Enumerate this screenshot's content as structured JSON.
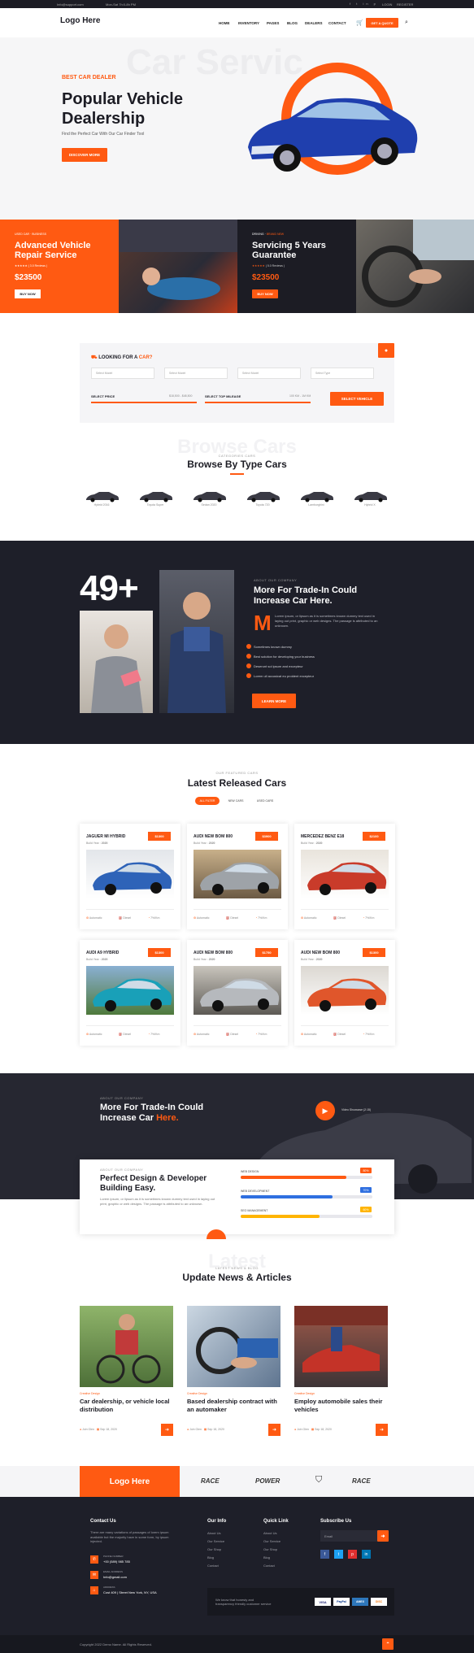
{
  "topbar": {
    "email": "Info@support.com",
    "hours": "Mon-Sat 7h:0-8h PM",
    "login": "LOGIN",
    "register": "REGISTER"
  },
  "nav": {
    "logo": "Logo Here",
    "items": [
      "HOME",
      "INVENTORY",
      "PAGES",
      "BLOG",
      "DEALERS",
      "CONTACT"
    ],
    "cta": "GET A QUOTE"
  },
  "hero": {
    "eyebrow": "BEST CAR DEALER",
    "title_line1": "Popular Vehicle",
    "title_line2": "Dealership",
    "subtitle": "Find the Perfect Car With Our Car Finder Tool",
    "button": "DISCOVER MORE",
    "bg_text": "Car Servic"
  },
  "promo": [
    {
      "tag1": "USED CAR",
      "tag2": "BUSINESS",
      "title1": "Advanced Vehicle",
      "title2": "Repair Service",
      "reviews": "( 3.0 Reviews )",
      "price": "$23500",
      "button": "BUY NOW"
    },
    {
      "tag1": "DRIVING",
      "tag2": "BRAND NEW",
      "title1": "Servicing 5 Years",
      "title2": "Guarantee",
      "reviews": "( 5.0 Reviews )",
      "price": "$23500",
      "button": "BUY NOW"
    }
  ],
  "search": {
    "heading_pre": "LOOKING FOR A ",
    "heading_accent": "CAR?",
    "selects": [
      "Select Model",
      "Select Model",
      "Select Model",
      "Select Type"
    ],
    "price_label": "SELECT PRICE",
    "price_range": "$18,500 - $48,500",
    "mileage_label": "SELECT TOP MILEAGE",
    "mileage_range": "100 KM - 1M KM",
    "button": "SELECT VEHICLE"
  },
  "types": {
    "bg": "Browse Cars",
    "pre": "CATEGORIES CARS",
    "title": "Browse By Type Cars",
    "items": [
      "Hybrid 2016",
      "Toyota Super",
      "Sedan 2020",
      "Toyota 720",
      "Lamborghini",
      "Hybrid X"
    ]
  },
  "about": {
    "counter": "49+",
    "pre": "ABOUT OUR COMPANY",
    "title_line1": "More For Trade-In Could",
    "title_line2": "Increase Car Here.",
    "dropcap": "M",
    "body": "Lorem ipsum, or lipsum as it is sometimes known dummy text used in laying out print, graphic or web designs. The passage is attributed to an unknown.",
    "list": [
      "Sometimes known dummy",
      "Best solution for developing your business",
      "Deserunt sol ipsum and excepteur",
      "Lorem ull accusicat eu proident excepteur"
    ],
    "button": "LEARN MORE"
  },
  "latest": {
    "pre": "OUR FEATURED CARS",
    "title": "Latest Released Cars",
    "tabs": [
      "ALL FILTER",
      "NEW CARS",
      "USED CARS"
    ],
    "year_prefix": "Build Year : ",
    "cars": [
      {
        "name": "JAGUER MI HYBRID",
        "price": "$1300",
        "year": "2020",
        "specs": [
          "Automatic",
          "Diesel",
          "7%/Km"
        ]
      },
      {
        "name": "AUDI NEW BOM 800",
        "price": "$3900",
        "year": "2020",
        "specs": [
          "Automatic",
          "Diesel",
          "7%/Km"
        ]
      },
      {
        "name": "MERCEDEZ BENZ E18",
        "price": "$2100",
        "year": "2020",
        "specs": [
          "Automatic",
          "Diesel",
          "7%/Km"
        ]
      },
      {
        "name": "AUDI A9 HYBRID",
        "price": "$1300",
        "year": "2020",
        "specs": [
          "Automatic",
          "Diesel",
          "7%/Km"
        ]
      },
      {
        "name": "AUDI NEW BOM 800",
        "price": "$1750",
        "year": "2020",
        "specs": [
          "Automatic",
          "Diesel",
          "7%/Km"
        ]
      },
      {
        "name": "AUDI NEW BOM 800",
        "price": "$1300",
        "year": "2020",
        "specs": [
          "Automatic",
          "Diesel",
          "7%/Km"
        ]
      }
    ]
  },
  "video": {
    "pre": "ABOUT OUR COMPANY",
    "title_line1": "More For Trade-In Could",
    "title_line2_plain": "Increase Car ",
    "title_line2_accent": "Here.",
    "label": "Video Showcase (2:15)"
  },
  "skills": {
    "pre": "ABOUT OUR COMPANY",
    "title_line1": "Perfect Design & Developer",
    "title_line2": "Building Easy.",
    "body": "Lorem ipsum, or lipsum as it is sometimes known dummy text used in laying out print, graphic or web designs. The passage is attributed to an unknown.",
    "bars": [
      {
        "label": "WEB DESIGN",
        "value": "80%",
        "pct": 80,
        "color": "#ff5a12"
      },
      {
        "label": "WEB DEVELOPMENT",
        "value": "70%",
        "pct": 70,
        "color": "#2f6fe0"
      },
      {
        "label": "SEO MANAGEMENT",
        "value": "60%",
        "pct": 60,
        "color": "#ffb400"
      }
    ]
  },
  "news": {
    "bg": "Latest",
    "pre": "LATEST NEWS & BLOG",
    "title": "Update News & Articles",
    "items": [
      {
        "cat": "Creative Design",
        "title": "Car dealership, or vehicle local distribution",
        "author": "Join Glen",
        "date": "Sep 18, 2020"
      },
      {
        "cat": "Creative Design",
        "title": "Based dealership contract with an automaker",
        "author": "Join Glen",
        "date": "Sep 18, 2020"
      },
      {
        "cat": "Creative Design",
        "title": "Employ automobile sales their vehicles",
        "author": "Join Glen",
        "date": "Sep 18, 2020"
      }
    ]
  },
  "brands": {
    "logo": "Logo Here",
    "names": [
      "RACE",
      "POWER",
      "RACE"
    ]
  },
  "footer": {
    "contact": {
      "title": "Contact Us",
      "body": "There are many variations of passages of lorem ipsum available but the majority have in some form, by ipsum injected.",
      "phone_label": "PHONE NUMBER",
      "phone": "+00 (589) 985 785",
      "email_label": "EMAIL ADDRESS",
      "email": "Info@gmail.com",
      "addr_label": "ADDRESS",
      "addr": "Cost 409 | Street New York, NY, USA"
    },
    "info": {
      "title": "Our Info",
      "links": [
        "About Us",
        "Our Service",
        "Our Shop",
        "Blog",
        "Contact"
      ]
    },
    "quick": {
      "title": "Quick Link",
      "links": [
        "About Us",
        "Our Service",
        "Our Shop",
        "Blog",
        "Contact"
      ]
    },
    "subscribe": {
      "title": "Subscribe Us",
      "placeholder": "Email"
    },
    "tagline": "We know that honesty and transparency friendly customer service",
    "copyright": "Copyright 2022 Demo Name. All Rights Reserved.",
    "payments": [
      "VISA",
      "PayPal",
      "AMEX",
      "DISC"
    ]
  },
  "colors": {
    "accent": "#ff5a12",
    "dark": "#1e1f29"
  }
}
